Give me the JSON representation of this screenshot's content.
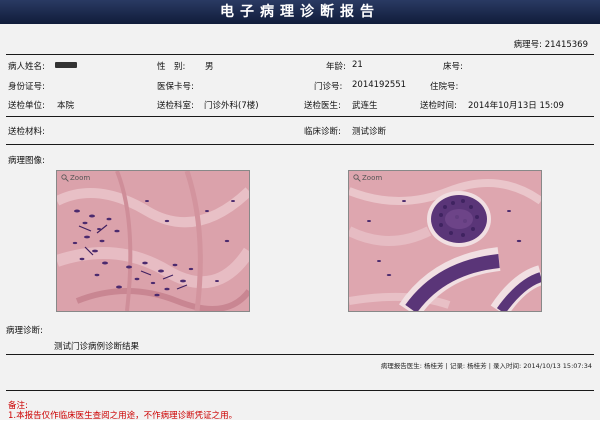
{
  "header": {
    "title": "电子病理诊断报告"
  },
  "report": {
    "path_no_label": "病理号:",
    "path_no": "21415369",
    "row1": {
      "name_label": "病人姓名:",
      "name_value": "",
      "sex_label": "性　别:",
      "sex_value": "男",
      "age_label": "年龄:",
      "age_value": "21",
      "bed_label": "床号:",
      "bed_value": ""
    },
    "row2": {
      "id_label": "身份证号:",
      "id_value": "",
      "insurance_label": "医保卡号:",
      "insurance_value": "",
      "clinic_label": "门诊号:",
      "clinic_value": "2014192551",
      "inpatient_label": "住院号:",
      "inpatient_value": ""
    },
    "row3": {
      "unit_label": "送检单位:",
      "unit_value": "本院",
      "dept_label": "送检科室:",
      "dept_value": "门诊外科(7楼)",
      "doctor_label": "送检医生:",
      "doctor_value": "武连生",
      "time_label": "送检时间:",
      "time_value": "2014年10月13日 15:09"
    },
    "row4": {
      "material_label": "送检材料:",
      "material_value": "",
      "clinical_label": "临床诊断:",
      "clinical_value": "测试诊断"
    },
    "images": {
      "label": "病理图像:",
      "zoom_left": "Zoom",
      "zoom_right": "Zoom"
    },
    "diagnosis": {
      "label": "病理诊断:",
      "text": "测试门诊病例诊断结果"
    },
    "signers": {
      "report_doctor_label": "病理报告医生:",
      "report_doctor": "杨桂芳",
      "recorder_label": "记录:",
      "recorder": "杨桂芳",
      "entry_time_label": "录入时间:",
      "entry_time": "2014/10/13 15:07:34"
    },
    "notes": {
      "title": "备注:",
      "line1": "1.本报告仅作临床医生查阅之用途，不作病理诊断凭证之用。"
    }
  },
  "colors": {
    "header_bg": "#1a2850",
    "note_red": "#cc0000",
    "tissue_pink": "#d89aa3",
    "nuclei_purple": "#4b2a6e"
  }
}
